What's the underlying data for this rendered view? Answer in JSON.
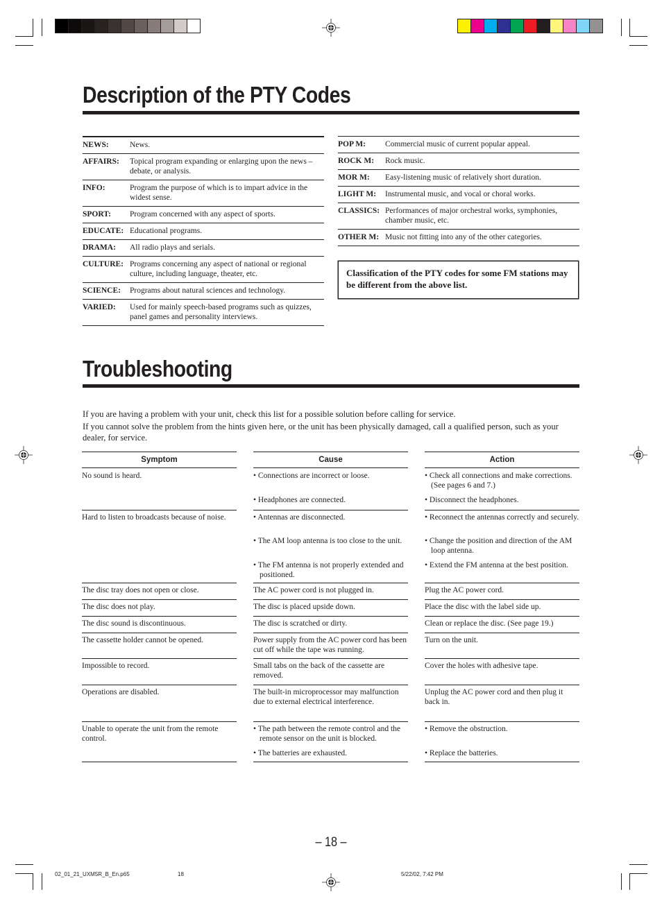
{
  "print_marks": {
    "grayscale_swatches": [
      "#000000",
      "#0d0b0a",
      "#1a1615",
      "#282220",
      "#3a3230",
      "#524845",
      "#6b605d",
      "#877c79",
      "#a59d9b",
      "#d2cbc9",
      "#ffffff"
    ],
    "color_swatches": [
      "#fff200",
      "#ec008c",
      "#00aeef",
      "#2e3192",
      "#00a651",
      "#ed1c24",
      "#231f20",
      "#fff57a",
      "#f585c5",
      "#7fd6f7",
      "#939191"
    ]
  },
  "pty_section": {
    "title": "Description of the PTY Codes",
    "left_codes": [
      {
        "code": "NEWS:",
        "description": "News."
      },
      {
        "code": "AFFAIRS:",
        "description": "Topical program expanding or enlarging upon the news – debate, or analysis."
      },
      {
        "code": "INFO:",
        "description": "Program the purpose of which is to impart advice in the widest sense."
      },
      {
        "code": "SPORT:",
        "description": "Program concerned with any aspect of sports."
      },
      {
        "code": "EDUCATE:",
        "description": "Educational programs."
      },
      {
        "code": "DRAMA:",
        "description": "All radio plays and serials."
      },
      {
        "code": "CULTURE:",
        "description": "Programs concerning any aspect of national or regional culture, including language, theater, etc."
      },
      {
        "code": "SCIENCE:",
        "description": "Programs about natural sciences and technology."
      },
      {
        "code": "VARIED:",
        "description": "Used for mainly speech-based programs such as quizzes, panel games and personality interviews."
      }
    ],
    "right_codes": [
      {
        "code": "POP M:",
        "description": "Commercial music of current popular appeal."
      },
      {
        "code": "ROCK M:",
        "description": "Rock music."
      },
      {
        "code": "MOR M:",
        "description": "Easy-listening music of relatively short duration."
      },
      {
        "code": "LIGHT M:",
        "description": "Instrumental music, and vocal or choral works."
      },
      {
        "code": "CLASSICS:",
        "description": "Performances of major orchestral works, symphonies, chamber music, etc."
      },
      {
        "code": "OTHER M:",
        "description": "Music not fitting into any of the other categories."
      }
    ],
    "note": "Classification of the PTY codes for some FM stations may be different from the above list."
  },
  "troubleshooting": {
    "title": "Troubleshooting",
    "intro": [
      "If you are having a problem with your unit, check this list for a possible solution before calling for service.",
      "If you cannot solve the problem from the hints given here, or the unit has been physically damaged, call a qualified person, such as your dealer, for service."
    ],
    "headers": {
      "symptom": "Symptom",
      "cause": "Cause",
      "action": "Action"
    },
    "rows": [
      {
        "symptom": "No sound is heard.",
        "causes": [
          "•  Connections are incorrect or loose.",
          "• Headphones are connected."
        ],
        "actions": [
          "•  Check all connections and make corrections. (See pages 6 and 7.)",
          "• Disconnect the headphones."
        ]
      },
      {
        "symptom": "Hard to listen to broadcasts because of noise.",
        "causes": [
          "• Antennas are disconnected.",
          "• The AM loop antenna is too close to the unit.",
          "• The FM antenna is not properly extended and positioned."
        ],
        "actions": [
          "• Reconnect the antennas correctly and securely.",
          "• Change the position and direction of the AM loop antenna.",
          "• Extend the FM antenna at the best position."
        ]
      },
      {
        "symptom": "The disc tray does not open or close.",
        "causes": [
          "The AC power cord is not plugged in."
        ],
        "actions": [
          "Plug the AC power cord."
        ]
      },
      {
        "symptom": "The disc does not play.",
        "causes": [
          "The disc is placed upside down."
        ],
        "actions": [
          "Place the disc with the label side up."
        ]
      },
      {
        "symptom": "The disc sound is discontinuous.",
        "causes": [
          "The disc is scratched or dirty."
        ],
        "actions": [
          "Clean or replace the disc. (See page 19.)"
        ]
      },
      {
        "symptom": "The cassette holder cannot be opened.",
        "causes": [
          "Power supply from the AC power cord has been cut off while the tape was running."
        ],
        "actions": [
          "Turn on the unit."
        ]
      },
      {
        "symptom": "Impossible to record.",
        "causes": [
          "Small tabs on the back of the cassette are removed."
        ],
        "actions": [
          "Cover the holes with adhesive tape."
        ]
      },
      {
        "symptom": "Operations are disabled.",
        "causes": [
          "The built-in microprocessor may malfunction due to external electrical interference."
        ],
        "actions": [
          "Unplug the AC power cord and then plug it back in."
        ]
      },
      {
        "symptom": "Unable to operate the unit from the remote control.",
        "causes": [
          "•  The path between the remote control and the remote sensor on the unit is blocked.",
          "• The batteries are exhausted."
        ],
        "actions": [
          "•  Remove the obstruction.",
          "• Replace the batteries."
        ]
      }
    ]
  },
  "page_number": "– 18 –",
  "footer": {
    "filename": "02_01_21_UXM5R_B_En.p65",
    "page": "18",
    "datetime": "5/22/02, 7:42 PM"
  }
}
